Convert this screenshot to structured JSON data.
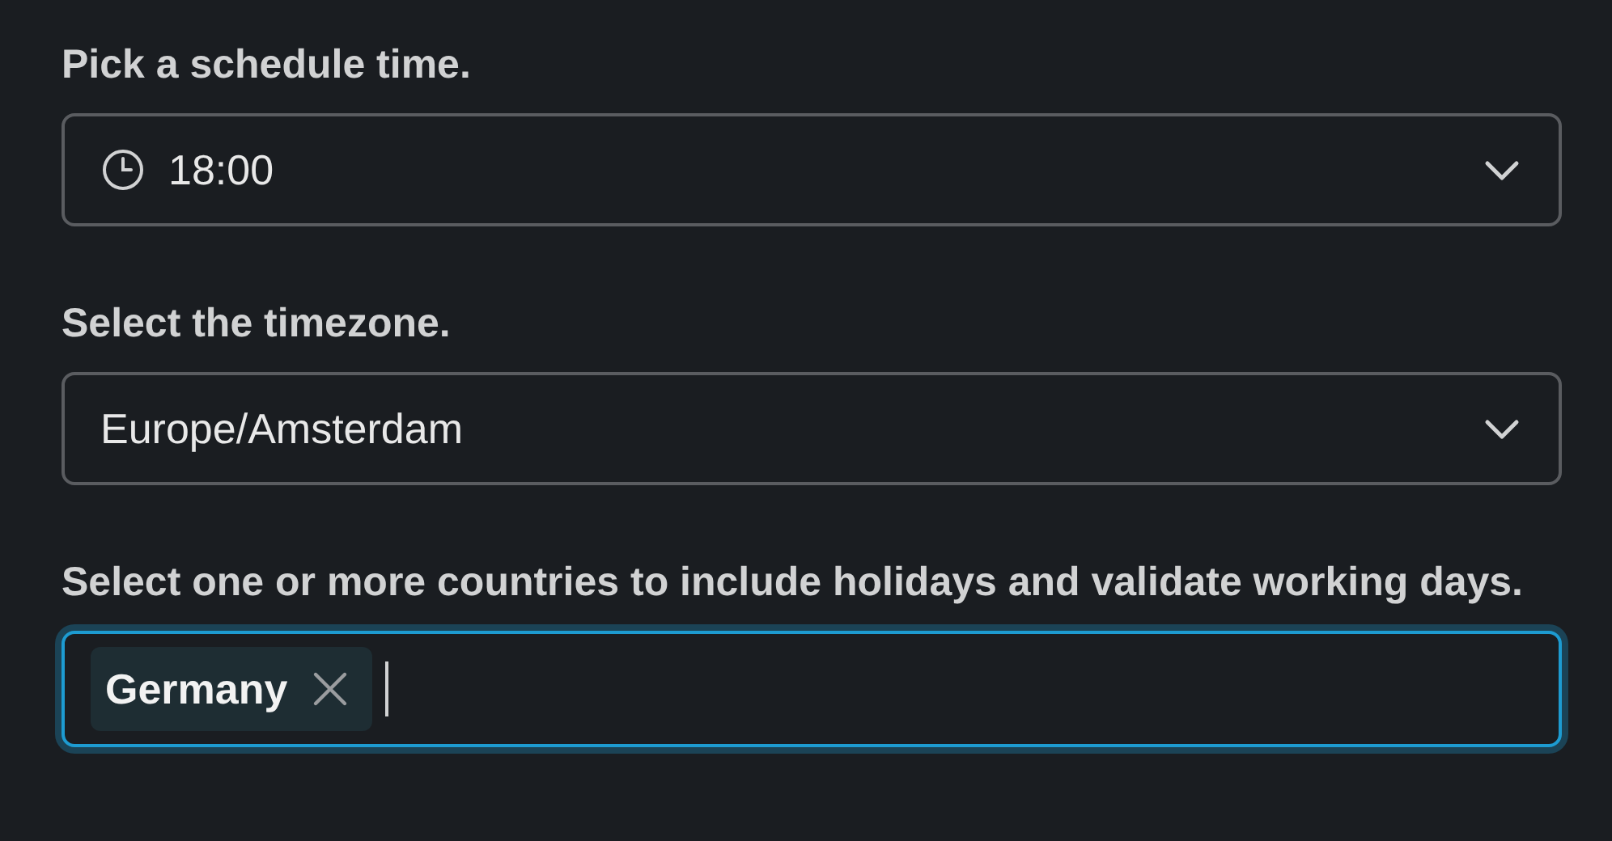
{
  "fields": [
    {
      "label": "Pick a schedule time.",
      "kind": "time",
      "value": "18:00",
      "focused": false
    },
    {
      "label": "Select the timezone.",
      "kind": "select",
      "value": "Europe/Amsterdam",
      "focused": false
    },
    {
      "label": "Select one or more countries to include holidays and validate working days.",
      "kind": "multi",
      "tags": [
        "Germany"
      ],
      "focused": true
    }
  ]
}
